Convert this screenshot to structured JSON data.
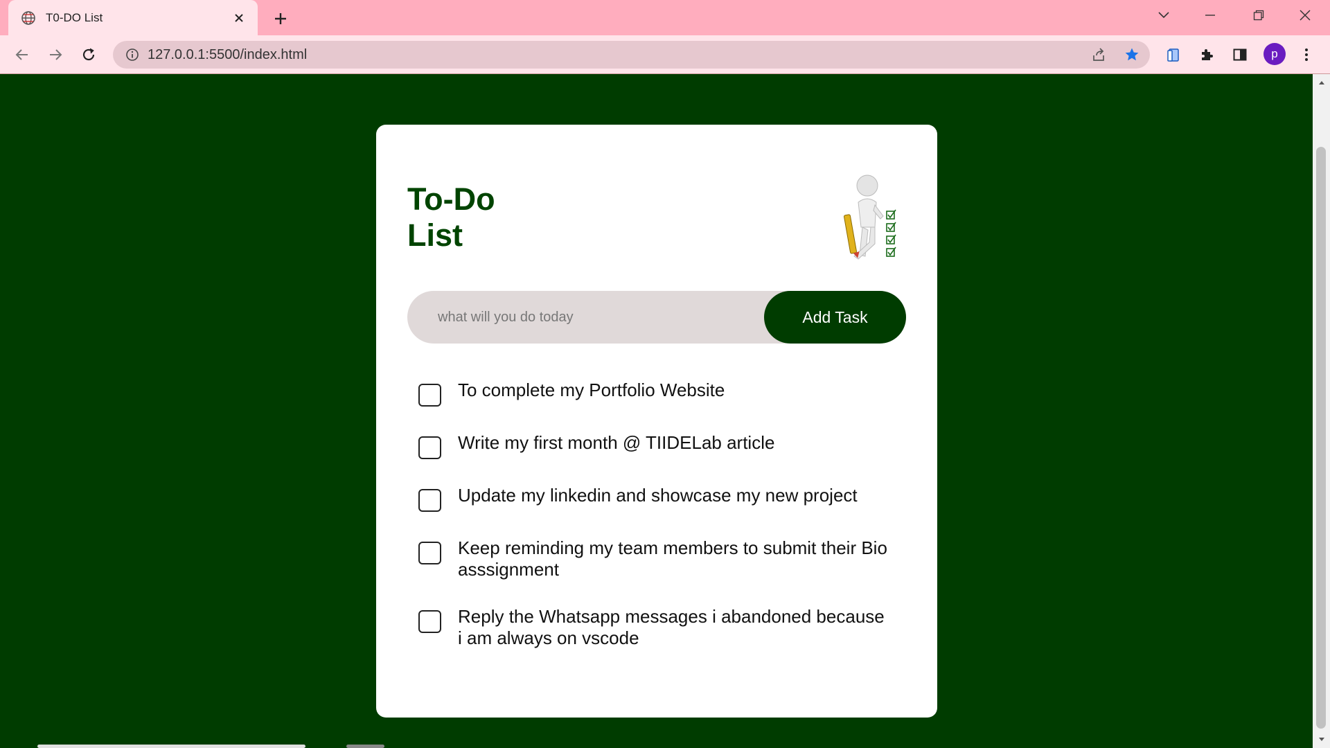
{
  "browser": {
    "tab_title": "T0-DO List",
    "url": "127.0.0.1:5500/index.html",
    "profile_initial": "p"
  },
  "app": {
    "title_line1": "To-Do",
    "title_line2": "List",
    "input_placeholder": "what will you do today",
    "add_button_label": "Add Task",
    "tasks": [
      {
        "text": "To complete my Portfolio Website",
        "checked": false
      },
      {
        "text": "Write my first month @ TIIDELab article",
        "checked": false
      },
      {
        "text": "Update my linkedin and showcase my new project",
        "checked": false
      },
      {
        "text": "Keep reminding my team members to submit their Bio asssignment",
        "checked": false
      },
      {
        "text": "Reply the Whatsapp messages i abandoned because i am always on vscode",
        "checked": false
      }
    ]
  },
  "colors": {
    "page_background": "#003c00",
    "accent": "#003c00",
    "title": "#004400",
    "tabstrip": "#ffadbe",
    "toolbar": "#ffe4ea",
    "avatar": "#6a1cc0"
  }
}
